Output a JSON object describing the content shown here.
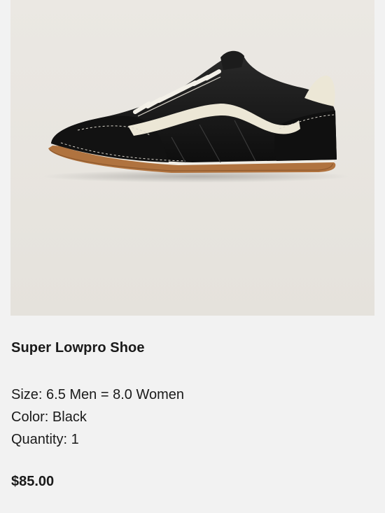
{
  "product": {
    "image_alt": "Super Lowpro Shoe",
    "title": "Super Lowpro Shoe",
    "size": "Size: 6.5 Men = 8.0 Women",
    "color": "Color: Black",
    "quantity": "Quantity: 1",
    "price": "$85.00"
  },
  "colors": {
    "page_background": "#f2f2f2",
    "image_background": "#e9e6e1",
    "shoe_primary": "#141414",
    "shoe_stripe": "#ece7d6",
    "sole": "#b0733f"
  }
}
